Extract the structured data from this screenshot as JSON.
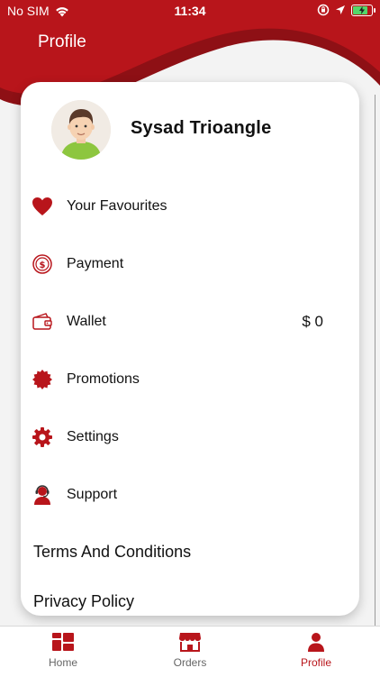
{
  "status_bar": {
    "carrier": "No SIM",
    "time": "11:34"
  },
  "header": {
    "title": "Profile"
  },
  "profile": {
    "name": "Sysad Trioangle"
  },
  "menu": [
    {
      "label": "Your Favourites",
      "icon": "heart-icon"
    },
    {
      "label": "Payment",
      "icon": "coin-icon"
    },
    {
      "label": "Wallet",
      "icon": "wallet-icon",
      "value": "$ 0"
    },
    {
      "label": "Promotions",
      "icon": "badge-icon"
    },
    {
      "label": "Settings",
      "icon": "gear-icon"
    },
    {
      "label": "Support",
      "icon": "support-agent-icon"
    }
  ],
  "links": [
    {
      "label": "Terms And Conditions"
    },
    {
      "label": "Privacy Policy"
    }
  ],
  "tabs": [
    {
      "label": "Home",
      "icon": "home-grid-icon"
    },
    {
      "label": "Orders",
      "icon": "store-icon"
    },
    {
      "label": "Profile",
      "icon": "person-icon",
      "active": true
    }
  ],
  "colors": {
    "brand": "#b8151b",
    "brand_dark": "#8e1015",
    "background": "#f3f3f3"
  }
}
